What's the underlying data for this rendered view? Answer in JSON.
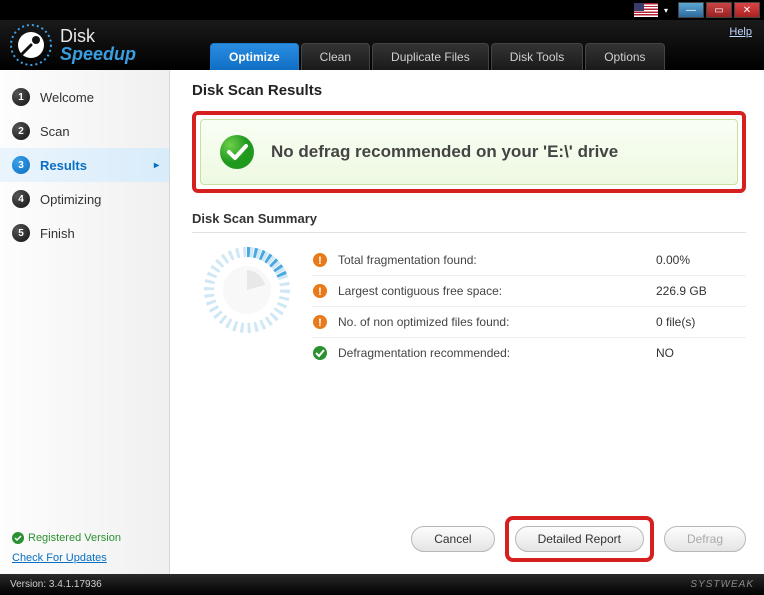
{
  "titlebar": {
    "help": "Help"
  },
  "logo": {
    "line1": "Disk",
    "line2": "Speedup"
  },
  "tabs": [
    {
      "label": "Optimize",
      "active": true
    },
    {
      "label": "Clean",
      "active": false
    },
    {
      "label": "Duplicate Files",
      "active": false
    },
    {
      "label": "Disk Tools",
      "active": false
    },
    {
      "label": "Options",
      "active": false
    }
  ],
  "sidebar": {
    "steps": [
      {
        "num": "1",
        "label": "Welcome",
        "active": false
      },
      {
        "num": "2",
        "label": "Scan",
        "active": false
      },
      {
        "num": "3",
        "label": "Results",
        "active": true
      },
      {
        "num": "4",
        "label": "Optimizing",
        "active": false
      },
      {
        "num": "5",
        "label": "Finish",
        "active": false
      }
    ],
    "registered": "Registered Version",
    "updates": "Check For Updates"
  },
  "main": {
    "title": "Disk Scan Results",
    "result_message": "No defrag recommended on your 'E:\\' drive",
    "summary_title": "Disk Scan Summary",
    "rows": [
      {
        "icon": "warn",
        "label": "Total fragmentation found:",
        "value": "0.00%"
      },
      {
        "icon": "warn",
        "label": "Largest contiguous free space:",
        "value": "226.9 GB"
      },
      {
        "icon": "warn",
        "label": "No. of non optimized files found:",
        "value": "0 file(s)"
      },
      {
        "icon": "ok",
        "label": "Defragmentation recommended:",
        "value": "NO"
      }
    ],
    "buttons": {
      "cancel": "Cancel",
      "detailed": "Detailed Report",
      "defrag": "Defrag"
    }
  },
  "status": {
    "version": "Version: 3.4.1.17936",
    "brand": "SYSTWEAK"
  }
}
